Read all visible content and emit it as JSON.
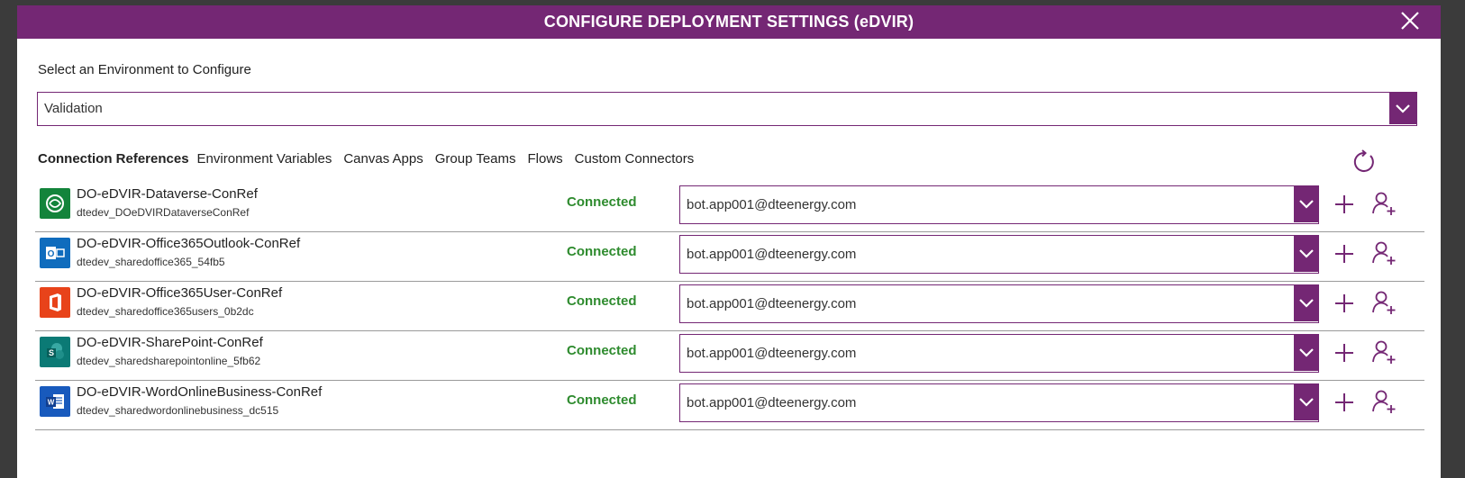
{
  "dialog": {
    "title": "CONFIGURE DEPLOYMENT SETTINGS (eDVIR)",
    "close_icon": "close-icon"
  },
  "environment": {
    "label": "Select an Environment to Configure",
    "selected": "Validation"
  },
  "tabs": [
    {
      "label": "Connection References",
      "active": true
    },
    {
      "label": "Environment Variables",
      "active": false
    },
    {
      "label": "Canvas Apps",
      "active": false
    },
    {
      "label": "Group Teams",
      "active": false
    },
    {
      "label": "Flows",
      "active": false
    },
    {
      "label": "Custom Connectors",
      "active": false
    }
  ],
  "refresh_icon": "refresh-icon",
  "rows": [
    {
      "name": "DO-eDVIR-Dataverse-ConRef",
      "logical": "dtedev_DOeDVIRDataverseConRef",
      "status": "Connected",
      "connection": "bot.app001@dteenergy.com",
      "icon": "dataverse-icon"
    },
    {
      "name": "DO-eDVIR-Office365Outlook-ConRef",
      "logical": "dtedev_sharedoffice365_54fb5",
      "status": "Connected",
      "connection": "bot.app001@dteenergy.com",
      "icon": "outlook-icon"
    },
    {
      "name": "DO-eDVIR-Office365User-ConRef",
      "logical": "dtedev_sharedoffice365users_0b2dc",
      "status": "Connected",
      "connection": "bot.app001@dteenergy.com",
      "icon": "office365-icon"
    },
    {
      "name": "DO-eDVIR-SharePoint-ConRef",
      "logical": "dtedev_sharedsharepointonline_5fb62",
      "status": "Connected",
      "connection": "bot.app001@dteenergy.com",
      "icon": "sharepoint-icon"
    },
    {
      "name": "DO-eDVIR-WordOnlineBusiness-ConRef",
      "logical": "dtedev_sharedwordonlinebusiness_dc515",
      "status": "Connected",
      "connection": "bot.app001@dteenergy.com",
      "icon": "word-icon"
    }
  ],
  "colors": {
    "brand": "#742774",
    "connected": "#2e8b2e"
  }
}
